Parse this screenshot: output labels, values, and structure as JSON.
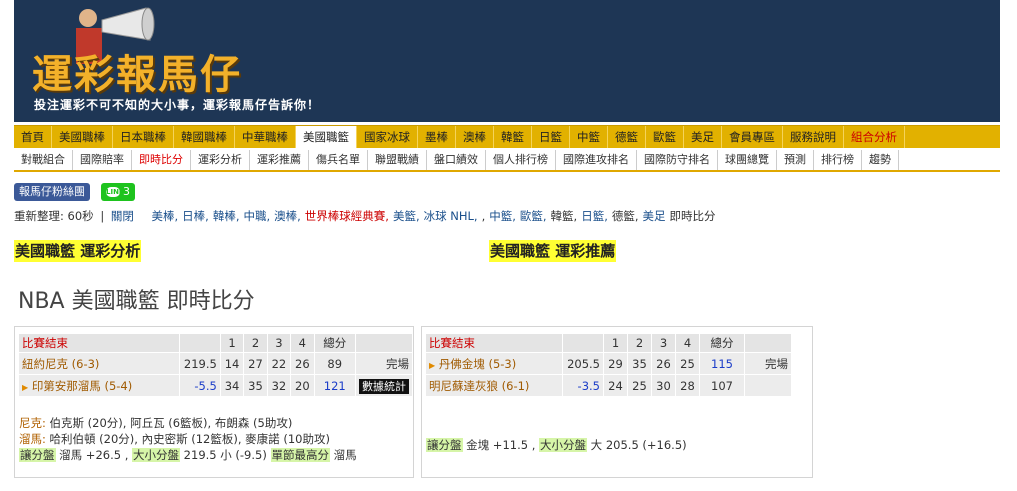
{
  "banner": {
    "logo": "運彩報馬仔",
    "slogan": "投注運彩不可不知的大小事，運彩報馬仔告訴你！"
  },
  "nav_main": [
    {
      "label": "首頁"
    },
    {
      "label": "美國職棒"
    },
    {
      "label": "日本職棒"
    },
    {
      "label": "韓國職棒"
    },
    {
      "label": "中華職棒"
    },
    {
      "label": "美國職籃",
      "active": true
    },
    {
      "label": "國家冰球"
    },
    {
      "label": "墨棒"
    },
    {
      "label": "澳棒"
    },
    {
      "label": "韓籃"
    },
    {
      "label": "日籃"
    },
    {
      "label": "中籃"
    },
    {
      "label": "德籃"
    },
    {
      "label": "歐籃"
    },
    {
      "label": "美足"
    },
    {
      "label": "會員專區"
    },
    {
      "label": "服務說明"
    },
    {
      "label": "組合分析",
      "red": true
    }
  ],
  "nav_sub": [
    {
      "label": "對戰組合"
    },
    {
      "label": "國際賠率"
    },
    {
      "label": "即時比分",
      "current": true
    },
    {
      "label": "運彩分析"
    },
    {
      "label": "運彩推薦"
    },
    {
      "label": "傷兵名單"
    },
    {
      "label": "聯盟戰績"
    },
    {
      "label": "盤口績效"
    },
    {
      "label": "個人排行榜"
    },
    {
      "label": "國際進攻排名"
    },
    {
      "label": "國際防守排名"
    },
    {
      "label": "球團總覽"
    },
    {
      "label": "預測"
    },
    {
      "label": "排行榜"
    },
    {
      "label": "趨勢"
    }
  ],
  "social": {
    "fb_label": "報馬仔粉絲團",
    "line_icon": "LINE",
    "line_count": "3"
  },
  "refresh": {
    "prefix": "重新整理: 60秒",
    "sep": "|",
    "close": "關閉",
    "links": [
      {
        "t": "美棒,"
      },
      {
        "t": "日棒,"
      },
      {
        "t": "韓棒,"
      },
      {
        "t": "中職,"
      },
      {
        "t": "澳棒,"
      },
      {
        "t": "世界棒球經典賽,",
        "red": true
      },
      {
        "t": "美籃,"
      },
      {
        "t": "冰球 NHL,"
      },
      {
        "t": ",",
        "plain": true
      },
      {
        "t": "中籃,"
      },
      {
        "t": "歐籃,"
      },
      {
        "t": "韓籃,",
        "plain": true
      },
      {
        "t": "日籃,"
      },
      {
        "t": "德籃,",
        "plain": true
      },
      {
        "t": "美足"
      },
      {
        "t": "即時比分",
        "plain": true
      }
    ]
  },
  "headline_left": "美國職籃 運彩分析",
  "headline_right": "美國職籃 運彩推薦",
  "page_title": "NBA 美國職籃 即時比分",
  "games": [
    {
      "status": "比賽結束",
      "q_headers": [
        "1",
        "2",
        "3",
        "4"
      ],
      "total_header": "總分",
      "rows": [
        {
          "team": "紐約尼克 (6-3)",
          "line": "219.5",
          "q": [
            "14",
            "27",
            "22",
            "26"
          ],
          "total": "89",
          "extra": "完場"
        },
        {
          "team": "印第安那溜馬 (5-4)",
          "line": "-5.5",
          "q": [
            "34",
            "35",
            "32",
            "20"
          ],
          "total": "121",
          "extra": "數據統計"
        }
      ],
      "notes": [
        [
          {
            "k": "尼克:"
          },
          {
            "t": " 伯克斯 (20分), 阿丘瓦 (6籃板), 布朗森 (5助攻)"
          }
        ],
        [
          {
            "k": "溜馬:"
          },
          {
            "t": " 哈利伯頓 (20分), 內史密斯 (12籃板), 麥康諾 (10助攻)"
          }
        ],
        [
          {
            "g": "讓分盤"
          },
          {
            "t": " 溜馬 +26.5 , "
          },
          {
            "g": "大小分盤"
          },
          {
            "t": " 219.5 小 (-9.5) "
          },
          {
            "g": "單節最高分"
          },
          {
            "t": " 溜馬"
          }
        ]
      ]
    },
    {
      "status": "比賽結束",
      "q_headers": [
        "1",
        "2",
        "3",
        "4"
      ],
      "total_header": "總分",
      "rows": [
        {
          "team": "丹佛金塊 (5-3)",
          "line": "205.5",
          "q": [
            "29",
            "35",
            "26",
            "25"
          ],
          "total": "115",
          "extra": "完場"
        },
        {
          "team": "明尼蘇達灰狼 (6-1)",
          "line": "-3.5",
          "q": [
            "24",
            "25",
            "30",
            "28"
          ],
          "total": "107",
          "extra": ""
        }
      ],
      "notes": [
        [
          {
            "g": "讓分盤"
          },
          {
            "t": " 金塊 +11.5 , "
          },
          {
            "g": "大小分盤"
          },
          {
            "t": " 大 205.5 (+16.5)"
          }
        ]
      ]
    }
  ]
}
